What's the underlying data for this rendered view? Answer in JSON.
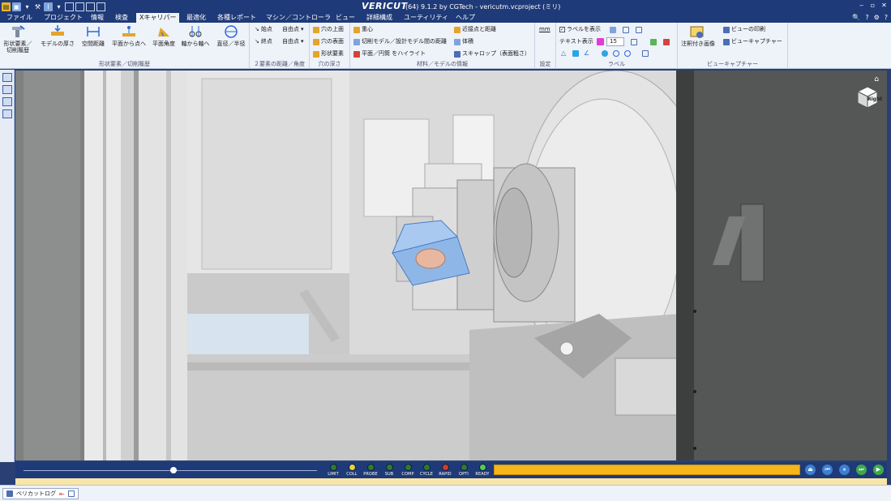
{
  "titlebar": {
    "logo": "VERICUT",
    "text": "(64)  9.1.2 by CGTech - vericutm.vcproject (ミリ)",
    "controls": [
      "‒",
      "▫",
      "✕"
    ]
  },
  "menu": {
    "tabs": [
      "ファイル",
      "プロジェクト",
      "情報",
      "検査",
      "Xキャリパー",
      "最適化",
      "各種レポート",
      "マシン／コントローラ",
      "ビュー",
      "詳細構成",
      "ユーティリティ",
      "ヘルプ"
    ],
    "active": "Xキャリパー",
    "right_controls": [
      "🔍",
      "?",
      "⚙",
      "?"
    ]
  },
  "ribbon": {
    "group_shape": {
      "label": "形状要素／切削履歴",
      "buttons": [
        "形状要素／\n切削履歴",
        "モデルの厚さ",
        "空間距離",
        "平面から点へ",
        "平面角度",
        "軸から軸へ",
        "直径／半径"
      ]
    },
    "group_distance": {
      "label": "２要素の距離／角度",
      "items": [
        "始点",
        "自由点",
        "終点",
        "自由点"
      ]
    },
    "group_hole": {
      "label": "穴の深さ",
      "items": [
        "穴の上面",
        "穴の表面",
        "形状要素"
      ]
    },
    "group_material": {
      "label": "材料／モデルの情報",
      "items": [
        "重心",
        "切削モデル／設計モデル間の距離",
        "平面／円筒 をハイライト",
        "近接点と距離",
        "体積",
        "スキャロップ（表面粗さ）"
      ]
    },
    "group_settings": {
      "label": "設定",
      "unit": "mm"
    },
    "group_label": {
      "label": "ラベル",
      "show_label": "ラベルを表示",
      "text_display": "テキスト表示",
      "font_size": "15"
    },
    "group_view": {
      "label": "ビューキャプチャー",
      "annotated": "注釈付き画像",
      "print": "ビューの印刷",
      "capture": "ビューキャプチャー"
    }
  },
  "viewport": {
    "viewcube_label": "Right",
    "home_icon": "⌂"
  },
  "playback": {
    "slider_fraction": 0.51,
    "leds": [
      {
        "label": "LIMIT",
        "color": "#2f7a2f"
      },
      {
        "label": "COLL",
        "color": "#e8d23a"
      },
      {
        "label": "PROBE",
        "color": "#2f7a2f"
      },
      {
        "label": "SUB",
        "color": "#2f7a2f"
      },
      {
        "label": "COMP",
        "color": "#2f7a2f"
      },
      {
        "label": "CYCLE",
        "color": "#2f7a2f"
      },
      {
        "label": "RAPID",
        "color": "#d63a2a"
      },
      {
        "label": "OPTI",
        "color": "#2f7a2f"
      },
      {
        "label": "READY",
        "color": "#5bc94a"
      }
    ],
    "progress_fraction": 1.0,
    "buttons": [
      "⏏",
      "⏮",
      "⏸",
      "⏭",
      "▶"
    ]
  },
  "statusbar": {
    "log_tab": "ベリカットログ"
  }
}
